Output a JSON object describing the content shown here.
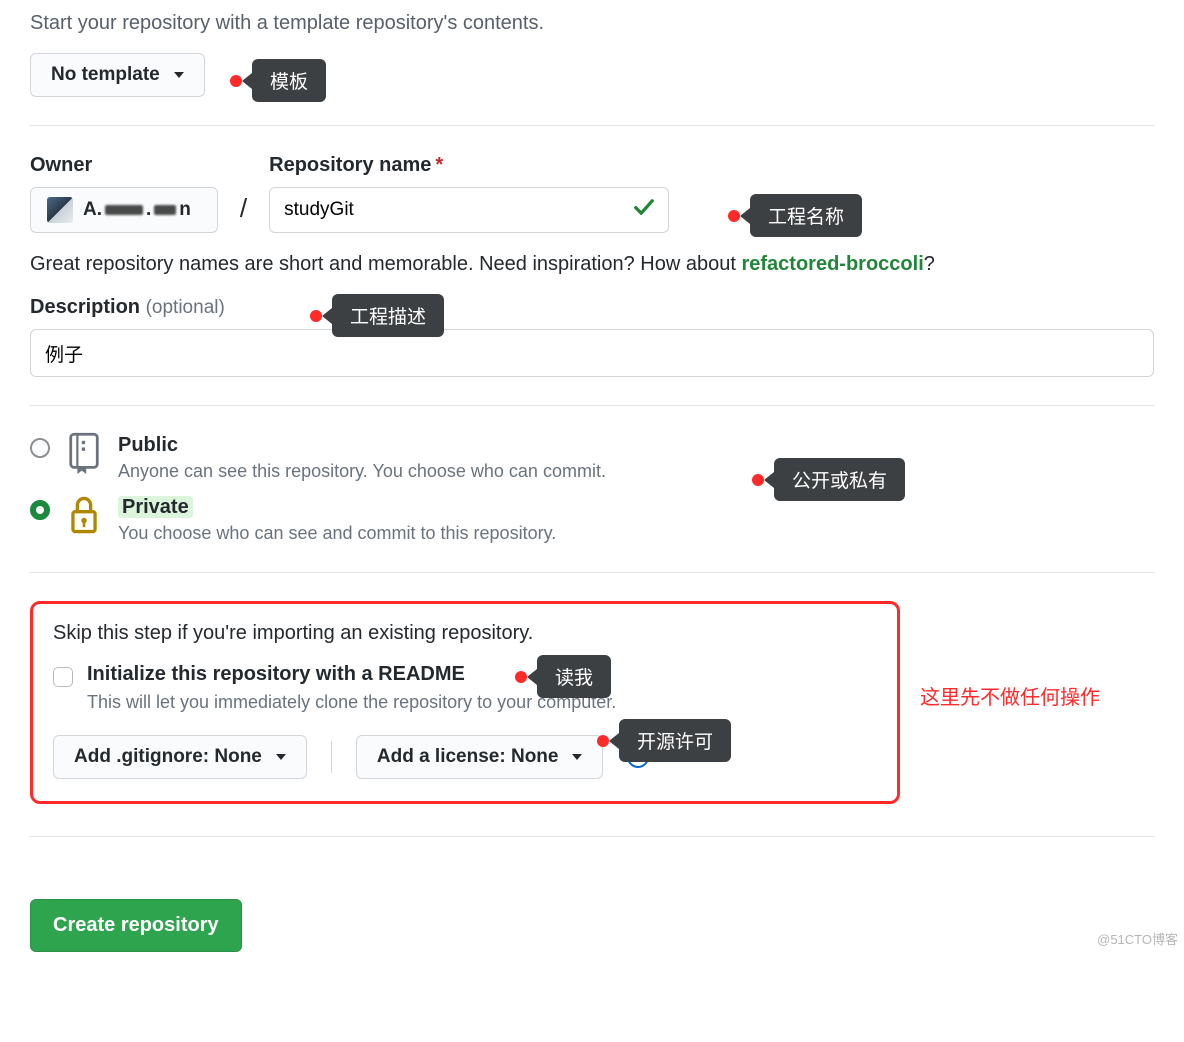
{
  "template": {
    "hint": "Start your repository with a template repository's contents.",
    "button": "No template"
  },
  "owner": {
    "label": "Owner",
    "name": "A...n"
  },
  "repo": {
    "label": "Repository name",
    "value": "studyGit"
  },
  "name_hint": {
    "prefix": "Great repository names are short and memorable. Need inspiration? How about ",
    "suggestion": "refactored-broccoli",
    "suffix": "?"
  },
  "description": {
    "label": "Description",
    "optional": "(optional)",
    "value": "例子"
  },
  "visibility": {
    "public": {
      "title": "Public",
      "desc": "Anyone can see this repository. You choose who can commit."
    },
    "private": {
      "title": "Private",
      "desc": "You choose who can see and commit to this repository."
    }
  },
  "init": {
    "skip": "Skip this step if you're importing an existing repository.",
    "readme_title": "Initialize this repository with a README",
    "readme_desc": "This will let you immediately clone the repository to your computer.",
    "gitignore_prefix": "Add .gitignore: ",
    "gitignore_value": "None",
    "license_prefix": "Add a license: ",
    "license_value": "None"
  },
  "submit": "Create repository",
  "annotations": {
    "template": "模板",
    "repo_name": "工程名称",
    "description": "工程描述",
    "visibility": "公开或私有",
    "readme": "读我",
    "license": "开源许可",
    "side_note": "这里先不做任何操作"
  },
  "watermark": "@51CTO博客"
}
